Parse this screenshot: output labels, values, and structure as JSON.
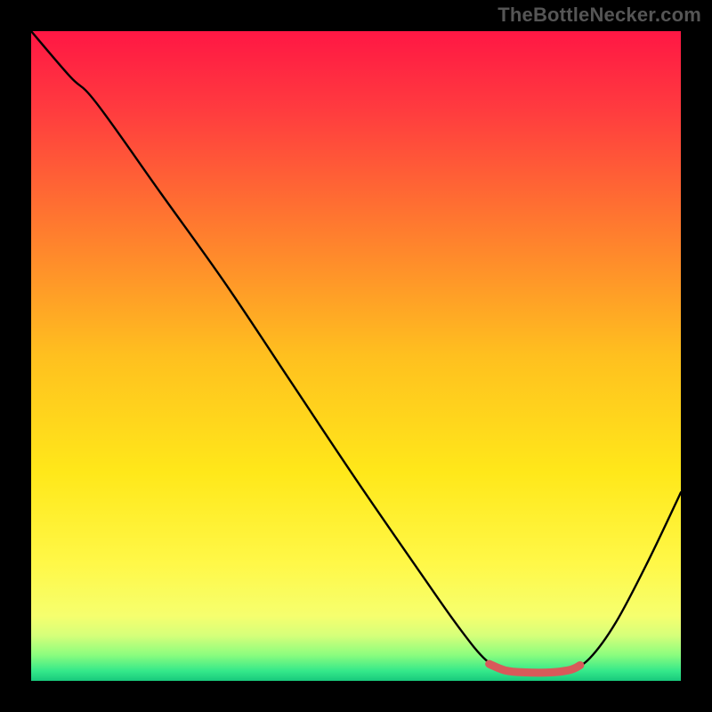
{
  "watermark": "TheBottleNecker.com",
  "chart_data": {
    "type": "line",
    "title": "",
    "xlabel": "",
    "ylabel": "",
    "xlim": [
      0,
      100
    ],
    "ylim": [
      0,
      100
    ],
    "gradient": {
      "stops": [
        {
          "offset": 0.0,
          "color": "#ff1744"
        },
        {
          "offset": 0.12,
          "color": "#ff3b3f"
        },
        {
          "offset": 0.3,
          "color": "#ff7a2f"
        },
        {
          "offset": 0.5,
          "color": "#ffc01f"
        },
        {
          "offset": 0.68,
          "color": "#ffe81a"
        },
        {
          "offset": 0.82,
          "color": "#fff848"
        },
        {
          "offset": 0.9,
          "color": "#f6ff6e"
        },
        {
          "offset": 0.93,
          "color": "#d6ff7a"
        },
        {
          "offset": 0.96,
          "color": "#8cfd7e"
        },
        {
          "offset": 0.985,
          "color": "#34e88a"
        },
        {
          "offset": 1.0,
          "color": "#18c97c"
        }
      ]
    },
    "curve_black": [
      {
        "x": 0,
        "y": 100
      },
      {
        "x": 6,
        "y": 93
      },
      {
        "x": 10,
        "y": 89
      },
      {
        "x": 20,
        "y": 75
      },
      {
        "x": 30,
        "y": 61
      },
      {
        "x": 40,
        "y": 46
      },
      {
        "x": 50,
        "y": 31
      },
      {
        "x": 60,
        "y": 16.5
      },
      {
        "x": 66,
        "y": 8
      },
      {
        "x": 70,
        "y": 3.2
      },
      {
        "x": 73,
        "y": 1.6
      },
      {
        "x": 76,
        "y": 1.3
      },
      {
        "x": 80,
        "y": 1.3
      },
      {
        "x": 83,
        "y": 1.7
      },
      {
        "x": 86,
        "y": 3.5
      },
      {
        "x": 90,
        "y": 9
      },
      {
        "x": 95,
        "y": 18.5
      },
      {
        "x": 100,
        "y": 29
      }
    ],
    "highlight": {
      "color": "#d85a5a",
      "points": [
        {
          "x": 70.5,
          "y": 2.6
        },
        {
          "x": 73,
          "y": 1.6
        },
        {
          "x": 76,
          "y": 1.3
        },
        {
          "x": 80,
          "y": 1.3
        },
        {
          "x": 83,
          "y": 1.7
        },
        {
          "x": 84.5,
          "y": 2.4
        }
      ]
    }
  }
}
